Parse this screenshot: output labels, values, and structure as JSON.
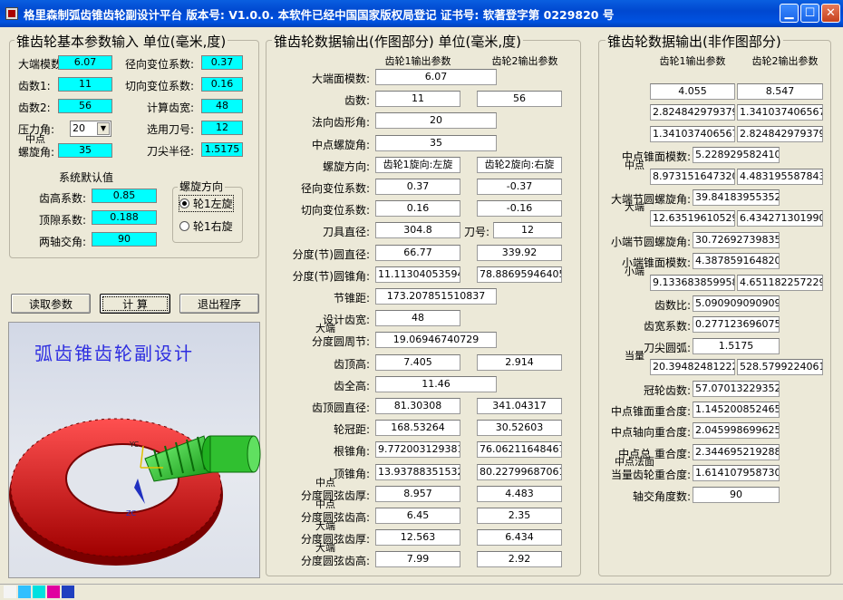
{
  "window": {
    "title": "格里森制弧齿锥齿轮副设计平台  版本号: V1.0.0.   本软件已经中国国家版权局登记   证书号: 软著登字第 0229820 号"
  },
  "input_panel": {
    "title": "锥齿轮基本参数输入 单位(毫米,度)",
    "fields": {
      "module_label": "大端模数:",
      "module": "6.07",
      "z1_label": "齿数1:",
      "z1": "11",
      "z2_label": "齿数2:",
      "z2": "56",
      "pressure_label": "压力角:",
      "pressure": "20",
      "helix_label_1": "中点",
      "helix_label_2": "螺旋角:",
      "helix": "35",
      "radial_shift_label": "径向变位系数:",
      "radial_shift": "0.37",
      "tangent_shift_label": "切向变位系数:",
      "tangent_shift": "0.16",
      "face_width_label": "计算齿宽:",
      "face_width": "48",
      "cutter_label": "选用刀号:",
      "cutter": "12",
      "tip_radius_label": "刀尖半径:",
      "tip_radius": "1.5175"
    },
    "defaults": {
      "title": "系统默认值",
      "addendum_label": "齿高系数:",
      "addendum": "0.85",
      "clearance_label": "顶隙系数:",
      "clearance": "0.188",
      "shaft_angle_label": "两轴交角:",
      "shaft_angle": "90"
    },
    "hand": {
      "title": "螺旋方向",
      "left_label": "轮1左旋",
      "right_label": "轮1右旋"
    },
    "buttons": {
      "read": "读取参数",
      "calc": "计  算",
      "exit": "退出程序"
    },
    "preview_title": "弧齿锥齿轮副设计",
    "preview_axis_yc": "YC",
    "preview_axis_zc": "ZC"
  },
  "drawing_panel": {
    "title": "锥齿轮数据输出(作图部分) 单位(毫米,度)",
    "col1": "齿轮1输出参数",
    "col2": "齿轮2输出参数",
    "rows": [
      {
        "label": "大端面模数:",
        "v1": "6.07",
        "span": true
      },
      {
        "label": "齿数:",
        "v1": "11",
        "v2": "56"
      },
      {
        "label": "法向齿形角:",
        "v1": "20",
        "span": true
      },
      {
        "label": "中点螺旋角:",
        "v1": "35",
        "span": true
      },
      {
        "label": "螺旋方向:",
        "v1": "齿轮1旋向:左旋",
        "v2": "齿轮2旋向:右旋"
      },
      {
        "label": "径向变位系数:",
        "v1": "0.37",
        "v2": "-0.37"
      },
      {
        "label": "切向变位系数:",
        "v1": "0.16",
        "v2": "-0.16"
      },
      {
        "label": "刀具直径:",
        "v1": "304.8",
        "mid_label": "刀号:",
        "v2": "12"
      },
      {
        "label": "分度(节)圆直径:",
        "v1": "66.77",
        "v2": "339.92"
      },
      {
        "label": "分度(节)圆锥角:",
        "v1": "11.113040535948",
        "v2": "78.886959464051"
      },
      {
        "label": "节锥距:",
        "v1": "173.207851510837",
        "span": true
      },
      {
        "label": "设计齿宽:",
        "v1": "48",
        "short": true
      },
      {
        "label_top": "大端",
        "label": "分度圆周节:",
        "v1": "19.06946740729",
        "span": true
      },
      {
        "label": "齿顶高:",
        "v1": "7.405",
        "v2": "2.914"
      },
      {
        "label": "齿全高:",
        "v1": "11.46",
        "span": true
      },
      {
        "label": "齿顶圆直径:",
        "v1": "81.30308",
        "v2": "341.04317"
      },
      {
        "label": "轮冠距:",
        "v1": "168.53264",
        "v2": "30.52603"
      },
      {
        "label": "根锥角:",
        "v1": "9.7720031293811",
        "v2": "76.062116484671"
      },
      {
        "label": "顶锥角:",
        "v1": "13.937883515328",
        "v2": "80.227996870618"
      },
      {
        "label_top": "中点",
        "label": "分度圆弦齿厚:",
        "v1": "8.957",
        "v2": "4.483"
      },
      {
        "label_top": "中点",
        "label": "分度圆弦齿高:",
        "v1": "6.45",
        "v2": "2.35"
      },
      {
        "label_top": "大端",
        "label": "分度圆弦齿厚:",
        "v1": "12.563",
        "v2": "6.434"
      },
      {
        "label_top": "大端",
        "label": "分度圆弦齿高:",
        "v1": "7.99",
        "v2": "2.92"
      }
    ]
  },
  "nondrawing_panel": {
    "title": "锥齿轮数据输出(非作图部分)",
    "col1": "齿轮1输出参数",
    "col2": "齿轮2输出参数",
    "rows": [
      {
        "label": "齿根高:",
        "v1": "4.055",
        "v2": "8.547"
      },
      {
        "label": "齿顶角:",
        "v1": "2.8248429793797",
        "v2": "1.3410374065671"
      },
      {
        "label": "齿根角:",
        "v1": "1.3410374065671",
        "v2": "2.8248429793797"
      },
      {
        "label": "中点锥面模数:",
        "v1": "5.22892958241057",
        "span": true
      },
      {
        "label_top": "中点",
        "label": "弧齿厚:",
        "v1": "8.9731516473207",
        "v2": "4.4831955878436"
      },
      {
        "label": "大端节圆螺旋角:",
        "v1": "39.841839553524",
        "span": true
      },
      {
        "label_top": "大端",
        "label": "弧齿厚:",
        "v1": "12.635196105299",
        "v2": "6.4342713019907"
      },
      {
        "label": "小端节圆螺旋角:",
        "v1": "30.726927398357",
        "span": true
      },
      {
        "label": "小端锥面模数:",
        "v1": "4.3878591648209",
        "span": true
      },
      {
        "label_top": "小端",
        "label": "弧齿厚:",
        "v1": "9.1336838599584",
        "v2": "4.6511822572297"
      },
      {
        "label": "齿数比:",
        "v1": "5.0909090909090",
        "span": true
      },
      {
        "label": "齿宽系数:",
        "v1": "0.2771236960756",
        "span": true
      },
      {
        "label": "刀尖圆弧:",
        "v1": "1.5175",
        "span": true,
        "center": true
      },
      {
        "label_top": "当量",
        "label": "齿数:",
        "v1": "20.394824812228",
        "v2": "528.57992240617"
      },
      {
        "label": "冠轮齿数:",
        "v1": "57.070132293521",
        "span": true
      },
      {
        "label": "中点锥面重合度:",
        "v1": "1.1452008524651",
        "span": true
      },
      {
        "label": "中点轴向重合度:",
        "v1": "2.0459986996251",
        "span": true
      },
      {
        "label": "中点总  重合度:",
        "v1": "2.3446952192885",
        "span": true
      },
      {
        "label_top": "中点法面",
        "label": "当量齿轮重合度:",
        "v1": "1.6141079587301",
        "span": true
      },
      {
        "label": "轴交角度数:",
        "v1": "90",
        "span": true,
        "center": true
      }
    ]
  },
  "colors": {
    "accent_cyan": "#00ffff",
    "gear_red": "#e02020",
    "pinion_green": "#30d030",
    "title_blue": "#2d2de0"
  }
}
